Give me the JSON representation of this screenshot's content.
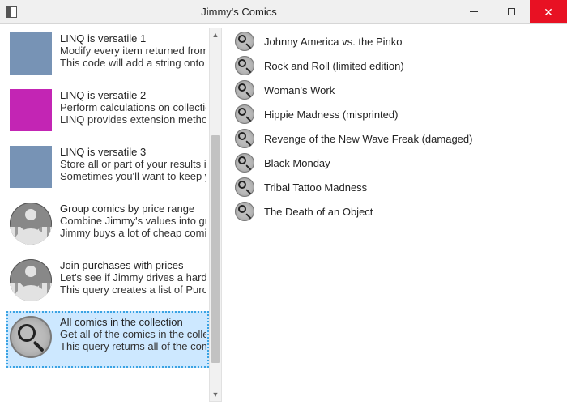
{
  "window": {
    "title": "Jimmy's Comics"
  },
  "colors": {
    "steelblue": "#7793b5",
    "magenta": "#c325b4"
  },
  "scrollbar": {
    "thumb_top_pct": 27,
    "thumb_height_pct": 66
  },
  "left_items": [
    {
      "icon": "color",
      "color_key": "steelblue",
      "selected": false,
      "title": "LINQ is versatile 1",
      "line2": "Modify every item returned from",
      "line3": "This code will add a string onto th"
    },
    {
      "icon": "color",
      "color_key": "magenta",
      "selected": false,
      "title": "LINQ is versatile 2",
      "line2": "Perform calculations on collection",
      "line3": "LINQ provides extension methods"
    },
    {
      "icon": "color",
      "color_key": "steelblue",
      "selected": false,
      "title": "LINQ is versatile 3",
      "line2": "Store all or part of your results in",
      "line3": "Sometimes you'll want to keep yo"
    },
    {
      "icon": "avatar",
      "selected": false,
      "title": "Group comics by price range",
      "line2": "Combine Jimmy's values into grou",
      "line3": "Jimmy buys a lot of cheap comic"
    },
    {
      "icon": "avatar",
      "selected": false,
      "title": "Join purchases with prices",
      "line2": "Let's see if Jimmy drives a hard ba",
      "line3": "This query creates a list of Purcha"
    },
    {
      "icon": "magnifier",
      "selected": true,
      "title": "All comics in the collection",
      "line2": "Get all of the comics in the collect",
      "line3": "This query returns all of the comic"
    }
  ],
  "right_items": [
    {
      "label": "Johnny America vs. the Pinko"
    },
    {
      "label": "Rock and Roll (limited edition)"
    },
    {
      "label": "Woman's Work"
    },
    {
      "label": "Hippie Madness (misprinted)"
    },
    {
      "label": "Revenge of the New Wave Freak (damaged)"
    },
    {
      "label": "Black Monday"
    },
    {
      "label": "Tribal Tattoo Madness"
    },
    {
      "label": "The Death of an Object"
    }
  ]
}
